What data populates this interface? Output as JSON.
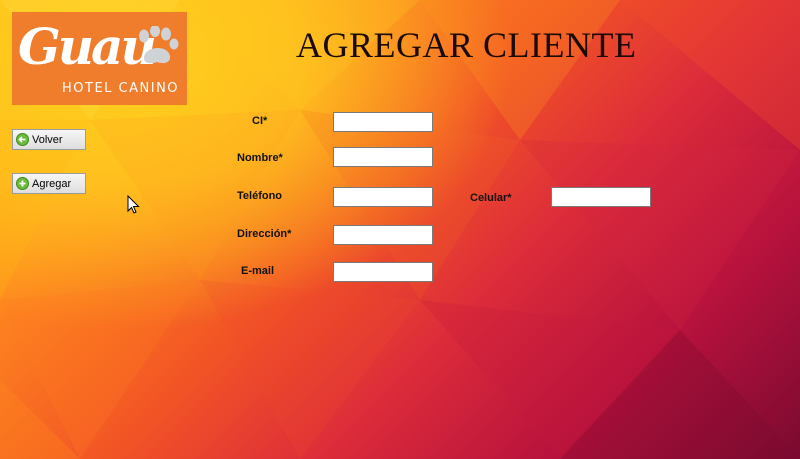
{
  "logo": {
    "script_text": "Guau",
    "sub_text": "HOTEL CANINO"
  },
  "page_title": "AGREGAR CLIENTE",
  "buttons": {
    "back": {
      "label": "Volver",
      "icon": "back-arrow-icon"
    },
    "add": {
      "label": "Agregar",
      "icon": "add-circle-icon"
    }
  },
  "form": {
    "ci": {
      "label": "CI*",
      "value": ""
    },
    "nombre": {
      "label": "Nombre*",
      "value": ""
    },
    "telefono": {
      "label": "Teléfono",
      "value": ""
    },
    "celular": {
      "label": "Celular*",
      "value": ""
    },
    "direccion": {
      "label": "Dirección*",
      "value": ""
    },
    "email": {
      "label": "E-mail",
      "value": ""
    }
  },
  "colors": {
    "logo_bg": "#ef7d2b",
    "title": "#1a0a0a"
  }
}
